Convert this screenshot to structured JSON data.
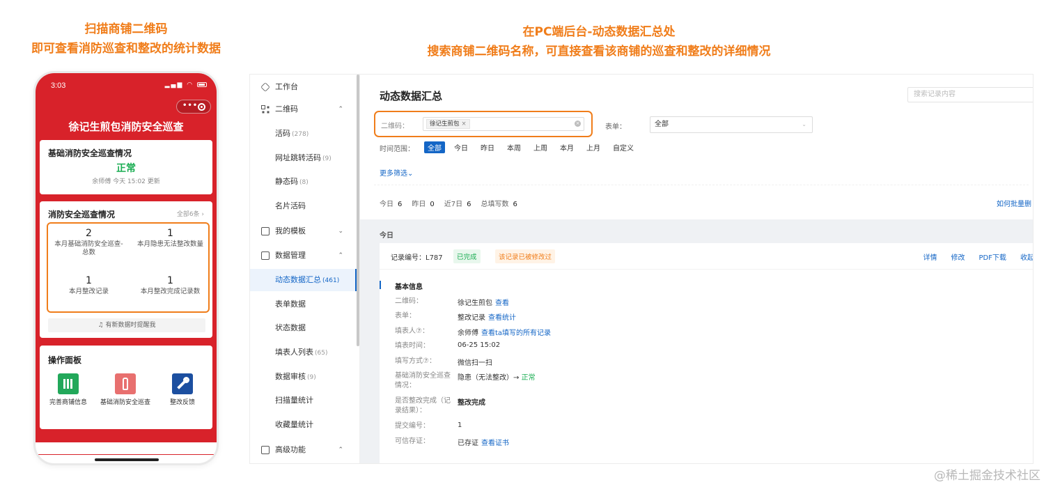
{
  "captions": {
    "left_line1": "扫描商铺二维码",
    "left_line2": "即可查看消防巡查和整改的统计数据",
    "right_line1": "在PC端后台-动态数据汇总处",
    "right_line2": "搜索商铺二维码名称，可直接查看该商铺的巡查和整改的详细情况"
  },
  "phone": {
    "time": "3:03",
    "capsule_dots": "•••",
    "title": "徐记生煎包消防安全巡查",
    "basic_card": {
      "title": "基础消防安全巡查情况",
      "status": "正常",
      "update_note": "余师傅 今天 15:02 更新"
    },
    "fire_card": {
      "title": "消防安全巡查情况",
      "view_all": "全部6条 ›",
      "stats": [
        {
          "num": "2",
          "label": "本月基础消防安全巡查-总数"
        },
        {
          "num": "1",
          "label": "本月隐患无法整改数量"
        },
        {
          "num": "1",
          "label": "本月整改记录"
        },
        {
          "num": "1",
          "label": "本月整改完成记录数"
        }
      ],
      "remind": "♫ 有新数据时提醒我"
    },
    "ops_card": {
      "title": "操作面板",
      "items": [
        {
          "label": "完善商铺信息",
          "icon": "books-icon"
        },
        {
          "label": "基础消防安全巡查",
          "icon": "fire-extinguisher-icon"
        },
        {
          "label": "整改反馈",
          "icon": "wrench-icon"
        }
      ]
    }
  },
  "admin": {
    "sidebar": [
      {
        "label": "工作台",
        "icon": "cube-icon",
        "chev": ""
      },
      {
        "label": "二维码",
        "icon": "qrcode-icon",
        "chev": "⌃"
      },
      {
        "label": "活码",
        "count": "(278)"
      },
      {
        "label": "网址跳转活码",
        "count": "(9)"
      },
      {
        "label": "静态码",
        "count": "(8)"
      },
      {
        "label": "名片活码",
        "count": ""
      },
      {
        "label": "我的模板",
        "icon": "template-icon",
        "chev": "⌄"
      },
      {
        "label": "数据管理",
        "icon": "chart-icon",
        "chev": "⌃"
      },
      {
        "label": "动态数据汇总",
        "count": "(461)"
      },
      {
        "label": "表单数据",
        "count": ""
      },
      {
        "label": "状态数据",
        "count": ""
      },
      {
        "label": "填表人列表",
        "count": "(65)"
      },
      {
        "label": "数据审核",
        "count": "(9)"
      },
      {
        "label": "扫描量统计",
        "count": ""
      },
      {
        "label": "收藏量统计",
        "count": ""
      },
      {
        "label": "高级功能",
        "icon": "briefcase-icon",
        "chev": "⌃"
      }
    ],
    "page_title": "动态数据汇总",
    "search_placeholder": "搜索记录内容",
    "filter": {
      "qr_label": "二维码：",
      "qr_tag": "徐记生煎包",
      "qr_tag_remove": "×",
      "qr_clear": "×",
      "form_label": "表单：",
      "form_value": "全部",
      "form_arrow": "⌄",
      "time_label": "时间范围：",
      "time_options": [
        "全部",
        "今日",
        "昨日",
        "本周",
        "上周",
        "本月",
        "上月",
        "自定义"
      ],
      "time_selected": "全部",
      "more": "更多筛选⌄"
    },
    "counts": [
      {
        "label": "今日",
        "value": "6"
      },
      {
        "label": "昨日",
        "value": "0"
      },
      {
        "label": "近7日",
        "value": "6"
      },
      {
        "label": "总填写数",
        "value": "6"
      }
    ],
    "batch_link": "如何批量删",
    "records": {
      "group_label": "今日",
      "record_no": "记录编号：L787",
      "badge_done": "已完成",
      "badge_modified": "该记录已被修改过",
      "actions": [
        "详情",
        "修改",
        "PDF下载",
        "收起"
      ],
      "section_title": "基本信息",
      "details": [
        {
          "key": "二维码：",
          "value": "徐记生煎包",
          "link": "查看"
        },
        {
          "key": "表单：",
          "value": "整改记录",
          "link": "查看统计"
        },
        {
          "key": "填表人⑦：",
          "value": "余师傅",
          "link": "查看ta填写的所有记录"
        },
        {
          "key": "填表时间：",
          "value": "06-25 15:02",
          "link": ""
        },
        {
          "key": "填写方式⑦：",
          "value": "微信扫一扫",
          "link": ""
        },
        {
          "key": "基础消防安全巡查情况：",
          "value": "隐患（无法整改）→",
          "ok": "正常"
        },
        {
          "key": "是否整改完成（记录结果）：",
          "value": "整改完成",
          "bold": true
        },
        {
          "key": "提交编号：",
          "value": "1",
          "link": ""
        },
        {
          "key": "可信存证：",
          "value": "已存证",
          "link": "查看证书"
        }
      ]
    }
  },
  "watermark": "@稀土掘金技术社区"
}
